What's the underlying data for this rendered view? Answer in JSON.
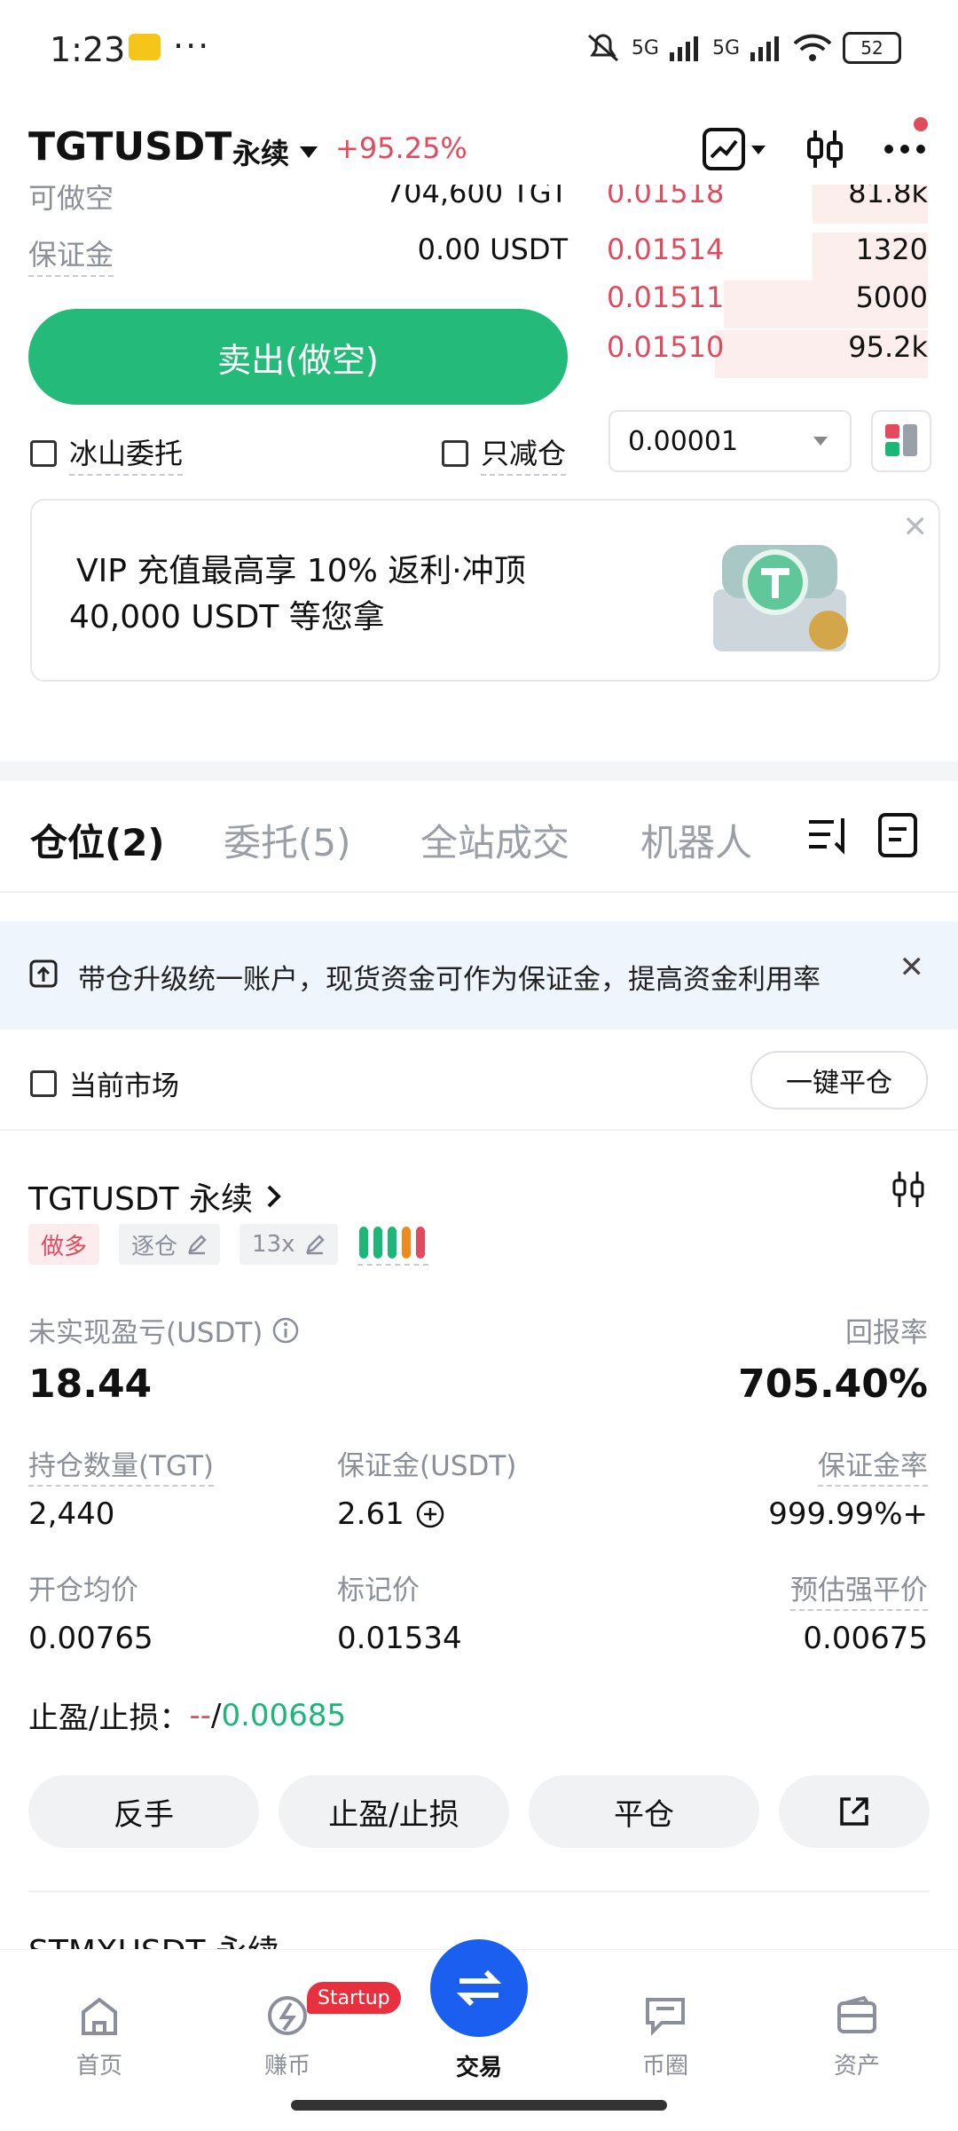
{
  "status_bar": {
    "time": "1:23",
    "network": "5G",
    "battery": "52"
  },
  "header": {
    "pair": "TGTUSDT",
    "contract_type": "永续",
    "change": "+95.25%"
  },
  "order_form": {
    "available_short_label": "可做空",
    "available_short_value": "704,600 TGT",
    "margin_label": "保证金",
    "margin_value": "0.00 USDT",
    "sell_button": "卖出(做空)",
    "iceberg_label": "冰山委托",
    "reduce_only_label": "只减仓"
  },
  "order_book": {
    "asks": [
      {
        "price": "0.01518",
        "size": "81.8k",
        "depth": 0.2
      },
      {
        "price": "0.01514",
        "size": "1320",
        "depth": 0.16
      },
      {
        "price": "0.01511",
        "size": "5000",
        "depth": 0.6
      },
      {
        "price": "0.01510",
        "size": "95.2k",
        "depth": 0.9
      }
    ],
    "tick_size": "0.00001"
  },
  "promo": {
    "line1": "VIP 充值最高享 10% 返利·冲顶",
    "line2": "40,000 USDT 等您拿"
  },
  "tabs": [
    {
      "label": "仓位(2)",
      "active": true
    },
    {
      "label": "委托(5)",
      "active": false
    },
    {
      "label": "全站成交",
      "active": false
    },
    {
      "label": "机器人",
      "active": false
    }
  ],
  "notice": {
    "text": "带仓升级统一账户，现货资金可作为保证金，提高资金利用率"
  },
  "filter": {
    "current_market_label": "当前市场",
    "close_all_button": "一键平仓"
  },
  "position": {
    "symbol": "TGTUSDT 永续",
    "side": "做多",
    "margin_mode": "逐仓",
    "leverage": "13x",
    "unrealized_pnl_label": "未实现盈亏(USDT)",
    "unrealized_pnl": "18.44",
    "roe_label": "回报率",
    "roe": "705.40%",
    "qty_label": "持仓数量(TGT)",
    "qty": "2,440",
    "margin_label": "保证金(USDT)",
    "margin": "2.61",
    "margin_ratio_label": "保证金率",
    "margin_ratio": "999.99%+",
    "entry_label": "开仓均价",
    "entry": "0.00765",
    "mark_label": "标记价",
    "mark": "0.01534",
    "liq_label": "预估强平价",
    "liq": "0.00675",
    "tpsl_label": "止盈/止损：",
    "tp": "--",
    "sl": "0.00685",
    "buttons": [
      "反手",
      "止盈/止损",
      "平仓"
    ]
  },
  "next_position": {
    "symbol": "STMXUSDT 永续"
  },
  "bottom_nav": [
    {
      "label": "首页",
      "icon": "home-icon"
    },
    {
      "label": "赚币",
      "icon": "earn-icon",
      "badge": "Startup"
    },
    {
      "label": "交易",
      "icon": "trade-icon",
      "active": true
    },
    {
      "label": "币圈",
      "icon": "community-icon"
    },
    {
      "label": "资产",
      "icon": "wallet-icon"
    }
  ],
  "colors": {
    "red": "#e24a5d",
    "green": "#1cb678",
    "blue": "#1a5ff0"
  }
}
